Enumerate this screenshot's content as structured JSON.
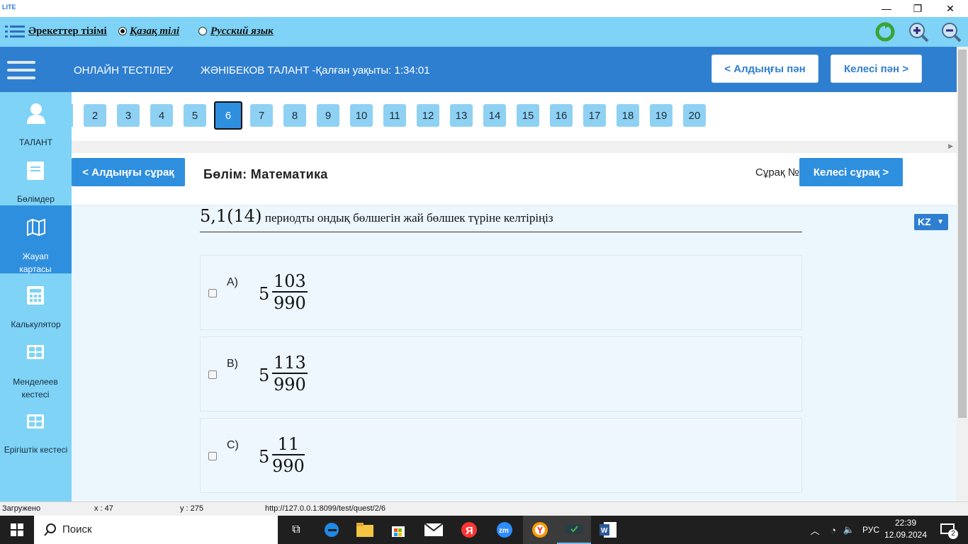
{
  "titlebar": {
    "app_label": "LITE",
    "minimize": "—",
    "restore": "❐",
    "close": "✕"
  },
  "menubar": {
    "actions_label": "Әрекеттер тізімі",
    "lang_kz_label": "Қазақ тілі",
    "lang_ru_label": "Русский язык"
  },
  "header": {
    "app_title": "ОНЛАЙН ТЕСТІЛЕУ",
    "user_timer": "ЖӘНІБЕКОВ ТАЛАНТ -Қалған уақыты: 1:34:01",
    "prev_subject": "< Алдыңғы пән",
    "next_subject": "Келесі пән >"
  },
  "sidebar": {
    "items": [
      {
        "label": "ТАЛАНТ",
        "icon": "user-icon"
      },
      {
        "label": "Бөлімдер",
        "icon": "book-icon"
      },
      {
        "label": "Жауап картасы",
        "icon": "map-icon",
        "active": true
      },
      {
        "label": "Калькулятор",
        "icon": "calculator-icon"
      },
      {
        "label": "Менделеев кестесі",
        "icon": "table-icon"
      },
      {
        "label": "Ерігіштік кестесі",
        "icon": "table-icon"
      }
    ]
  },
  "question_nav": {
    "numbers": [
      "2",
      "3",
      "4",
      "5",
      "6",
      "7",
      "8",
      "9",
      "10",
      "11",
      "12",
      "13",
      "14",
      "15",
      "16",
      "17",
      "18",
      "19",
      "20"
    ],
    "current": "6"
  },
  "content": {
    "prev_question": "< Алдыңғы сұрақ",
    "next_question": "Келесі сұрақ >",
    "section": "Бөлім: Математика",
    "question_no_label": "Сұрақ №",
    "question_math": "5,1(14)",
    "question_text": "периодты ондық бөлшегін жай бөлшек түріне келтіріңіз",
    "lang_select": "KZ",
    "options": [
      {
        "letter": "A)",
        "whole": "5",
        "numerator": "103",
        "denominator": "990"
      },
      {
        "letter": "B)",
        "whole": "5",
        "numerator": "113",
        "denominator": "990"
      },
      {
        "letter": "C)",
        "whole": "5",
        "numerator": "11",
        "denominator": "990"
      }
    ]
  },
  "statusbar": {
    "status": "Загружено",
    "x": "x : 47",
    "y": "y : 275",
    "url": "http://127.0.0.1:8099/test/quest/2/6"
  },
  "taskbar": {
    "search_label": "Поиск",
    "lang": "РУС",
    "time": "22:39",
    "date": "12.09.2024",
    "notifications": "2"
  },
  "colors": {
    "accent": "#2f7fd1",
    "menubar": "#7ed3f7",
    "button": "#2f8fdf"
  }
}
